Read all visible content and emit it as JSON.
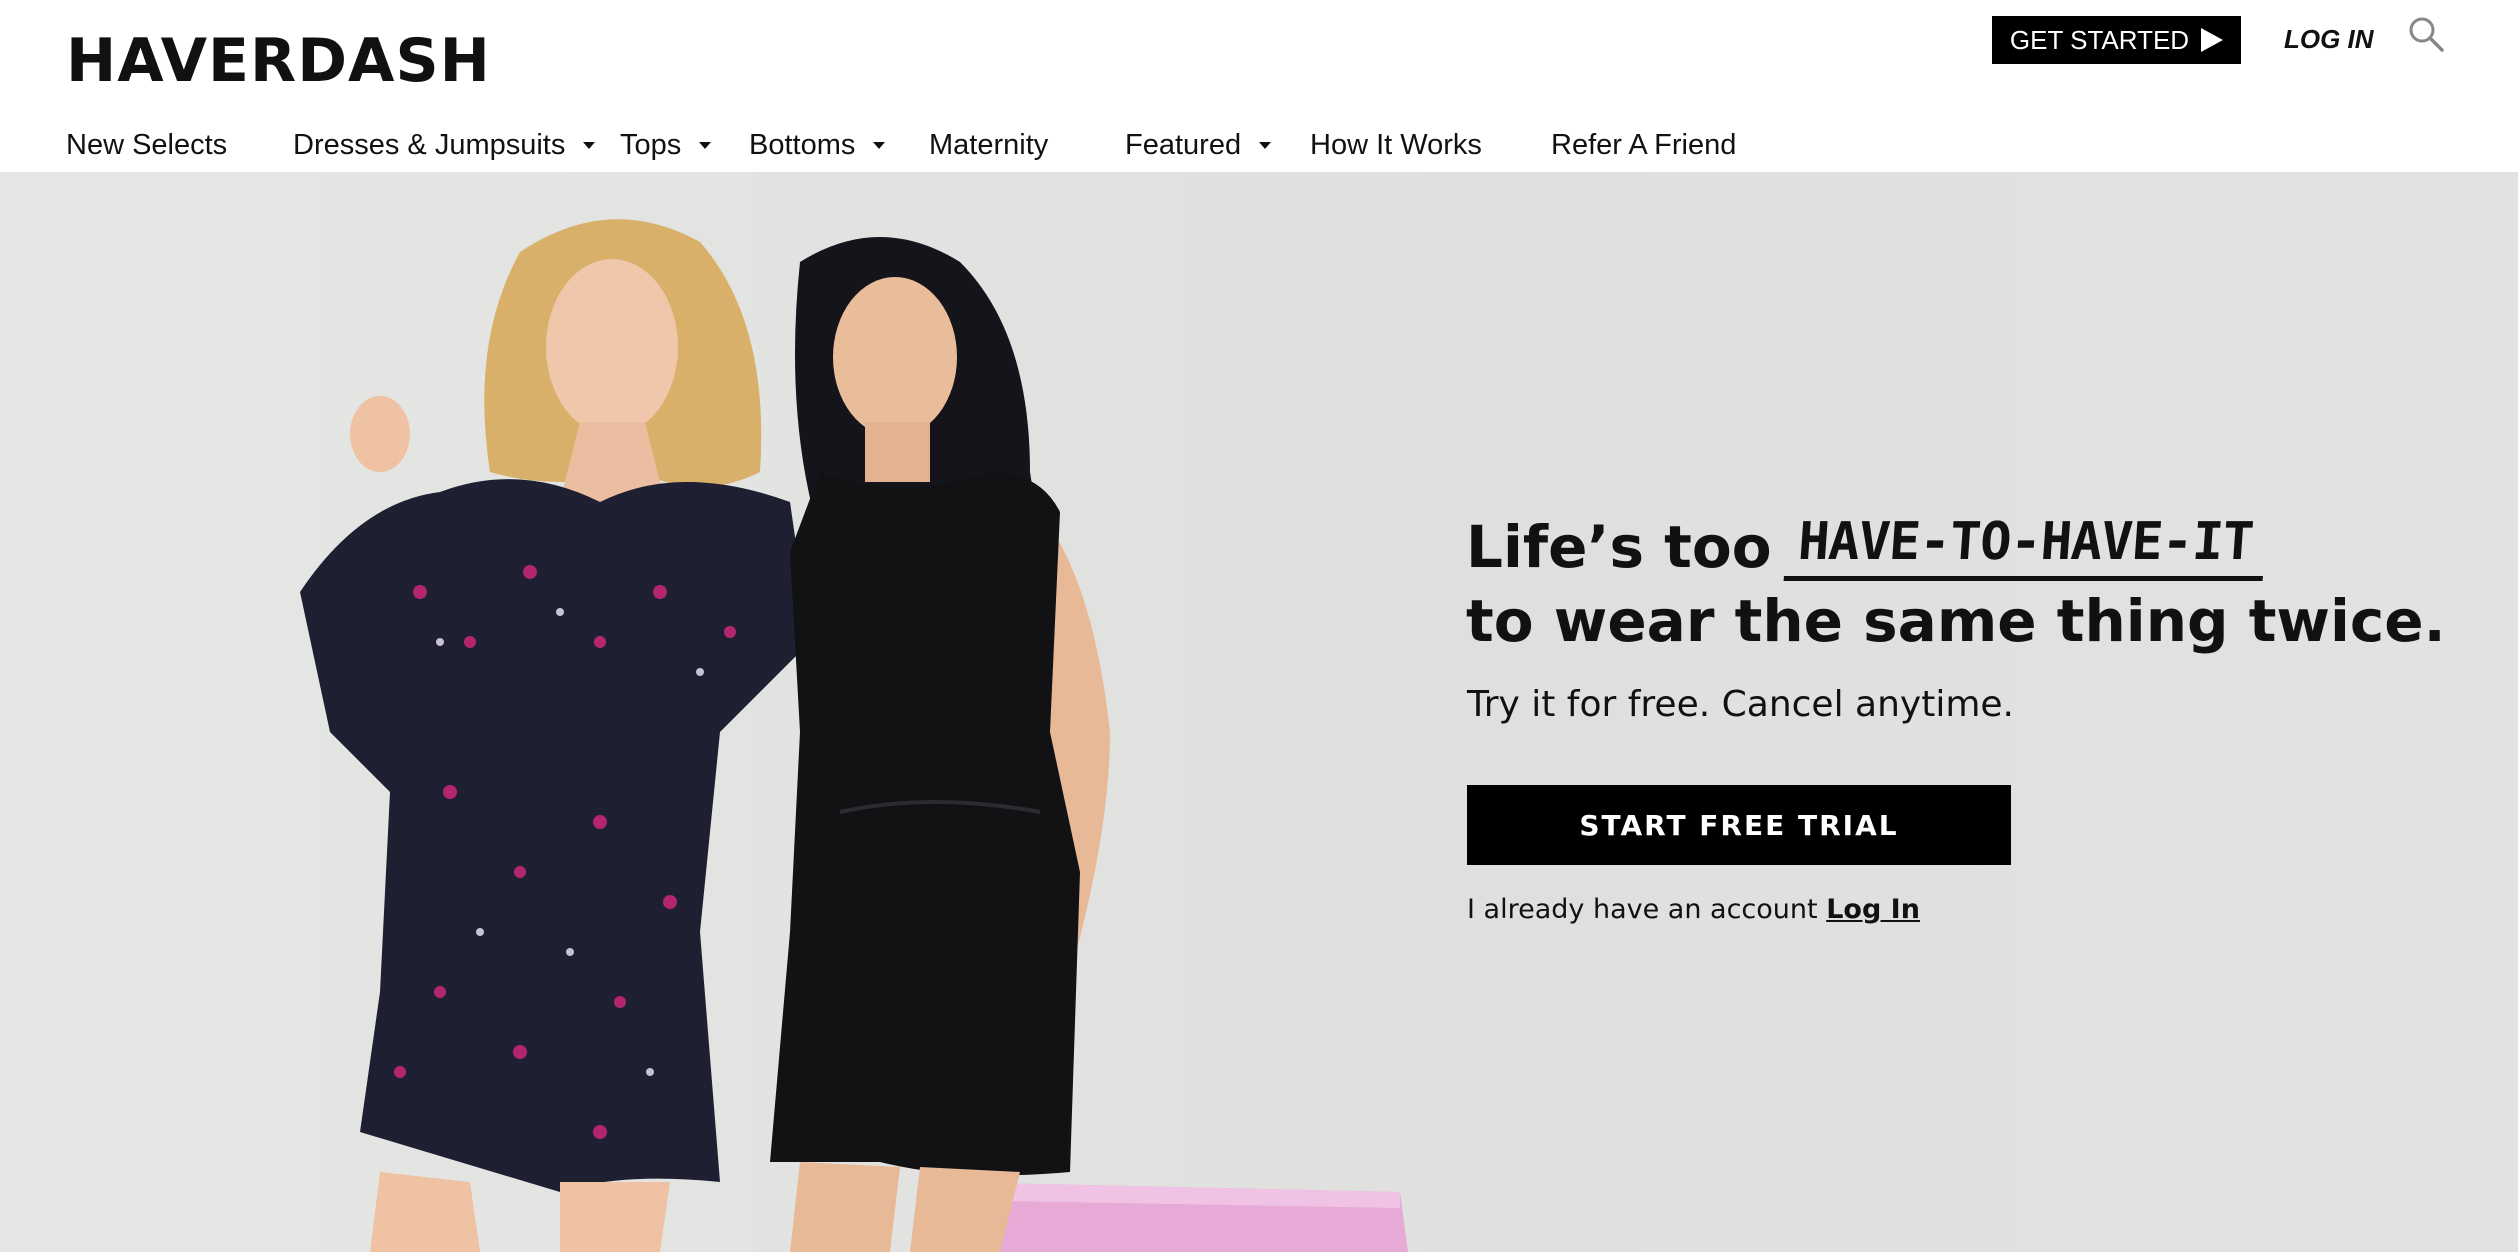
{
  "brand": {
    "logo_text": "HAVERDASH"
  },
  "header": {
    "get_started_label": "GET STARTED",
    "login_label": "LOG IN",
    "search_icon": "search-icon"
  },
  "nav": {
    "items": [
      {
        "label": "New Selects",
        "has_dropdown": false
      },
      {
        "label": "Dresses & Jumpsuits",
        "has_dropdown": true
      },
      {
        "label": "Tops",
        "has_dropdown": true
      },
      {
        "label": "Bottoms",
        "has_dropdown": true
      },
      {
        "label": "Maternity",
        "has_dropdown": false
      },
      {
        "label": "Featured",
        "has_dropdown": true
      },
      {
        "label": "How It Works",
        "has_dropdown": false
      },
      {
        "label": "Refer A Friend",
        "has_dropdown": false
      }
    ]
  },
  "hero": {
    "headline_prefix": "Life’s too",
    "headline_highlight": "HAVE-TO-HAVE-IT",
    "headline_line2": "to wear the same thing twice.",
    "subheadline": "Try it for free. Cancel anytime.",
    "cta_label": "START FREE TRIAL",
    "account_text": "I already have an account",
    "account_link": "Log In",
    "background_color": "#e2e3e1",
    "pedestal_color": "#e7a9d6"
  }
}
